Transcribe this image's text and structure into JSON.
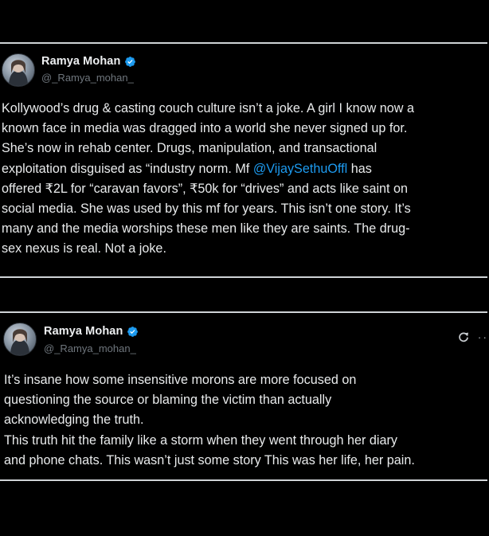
{
  "tweets": [
    {
      "display_name": "Ramya Mohan",
      "handle": "@_Ramya_mohan_",
      "verified": true,
      "text_parts": [
        "Kollywood’s drug & casting couch culture isn’t a joke. A girl I know now a\nknown face in media was dragged into a world she never signed up for.\nShe’s now in  rehab center. Drugs, manipulation, and transactional\nexploitation disguised as “industry norm. Mf ",
        "@VijaySethuOffl",
        " has\noffered ₹2L for “caravan favors”, ₹50k for “drives” and acts like saint on\nsocial media. She was used by this mf for years. This isn’t one story. It’s\nmany and the media worships these men like they are saints. The drug-\nsex nexus is real. Not a joke."
      ]
    },
    {
      "display_name": "Ramya Mohan",
      "handle": "@_Ramya_mohan_",
      "verified": true,
      "text": "It’s insane how some insensitive morons are more focused on\nquestioning the source or blaming the victim than actually\nacknowledging the truth.\nThis truth hit the family like a storm when they went through her diary\nand phone chats. This wasn’t just some story This was her life, her pain."
    }
  ],
  "icons": {
    "verified": "verified-badge-icon",
    "repost": "repost-icon",
    "more": "more-icon"
  },
  "colors": {
    "background": "#000000",
    "mention": "#1d9bf0",
    "verified": "#1d9bf0",
    "divider": "#cfd3d6"
  }
}
